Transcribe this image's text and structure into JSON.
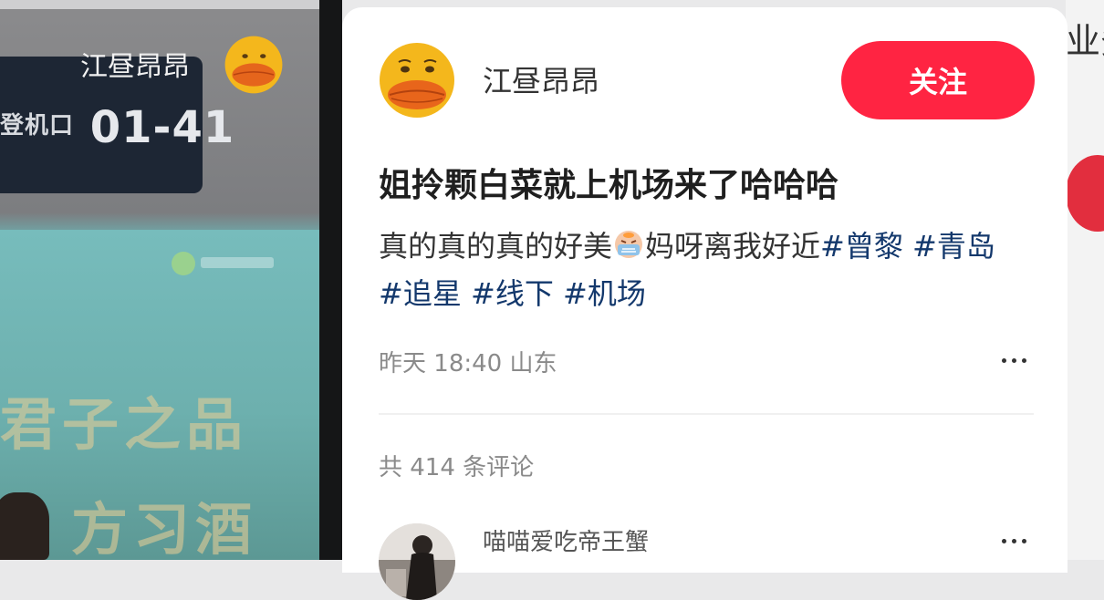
{
  "background_photo": {
    "gate_sign": {
      "prefix": "登机口",
      "number": "01-41"
    },
    "watermark_username": "江昼昂昂",
    "ad_text_line1": "君子之品",
    "ad_text_line2": "方习酒"
  },
  "right_edge": {
    "text": "业务"
  },
  "post": {
    "author": {
      "name": "江昼昂昂",
      "avatar_icon": "yellow-duck-avatar"
    },
    "follow_label": "关注",
    "title": "姐拎颗白菜就上机场来了哈哈哈",
    "body": {
      "text_before_emoji": "真的真的真的好美",
      "emoji": "crying-face-emoji",
      "text_after_emoji": "妈呀离我好近",
      "tags": [
        "#曾黎",
        "#青岛",
        "#追星",
        "#线下",
        "#机场"
      ]
    },
    "meta": {
      "date": "昨天",
      "time": "18:40",
      "location": "山东"
    },
    "more_icon": "ellipsis-icon"
  },
  "comments": {
    "count_label": "共 414 条评论",
    "first": {
      "username": "喵喵爱吃帝王蟹"
    }
  },
  "colors": {
    "accent": "#ff2442",
    "tag": "#13386c",
    "secondary_text": "#8a8a8a"
  }
}
